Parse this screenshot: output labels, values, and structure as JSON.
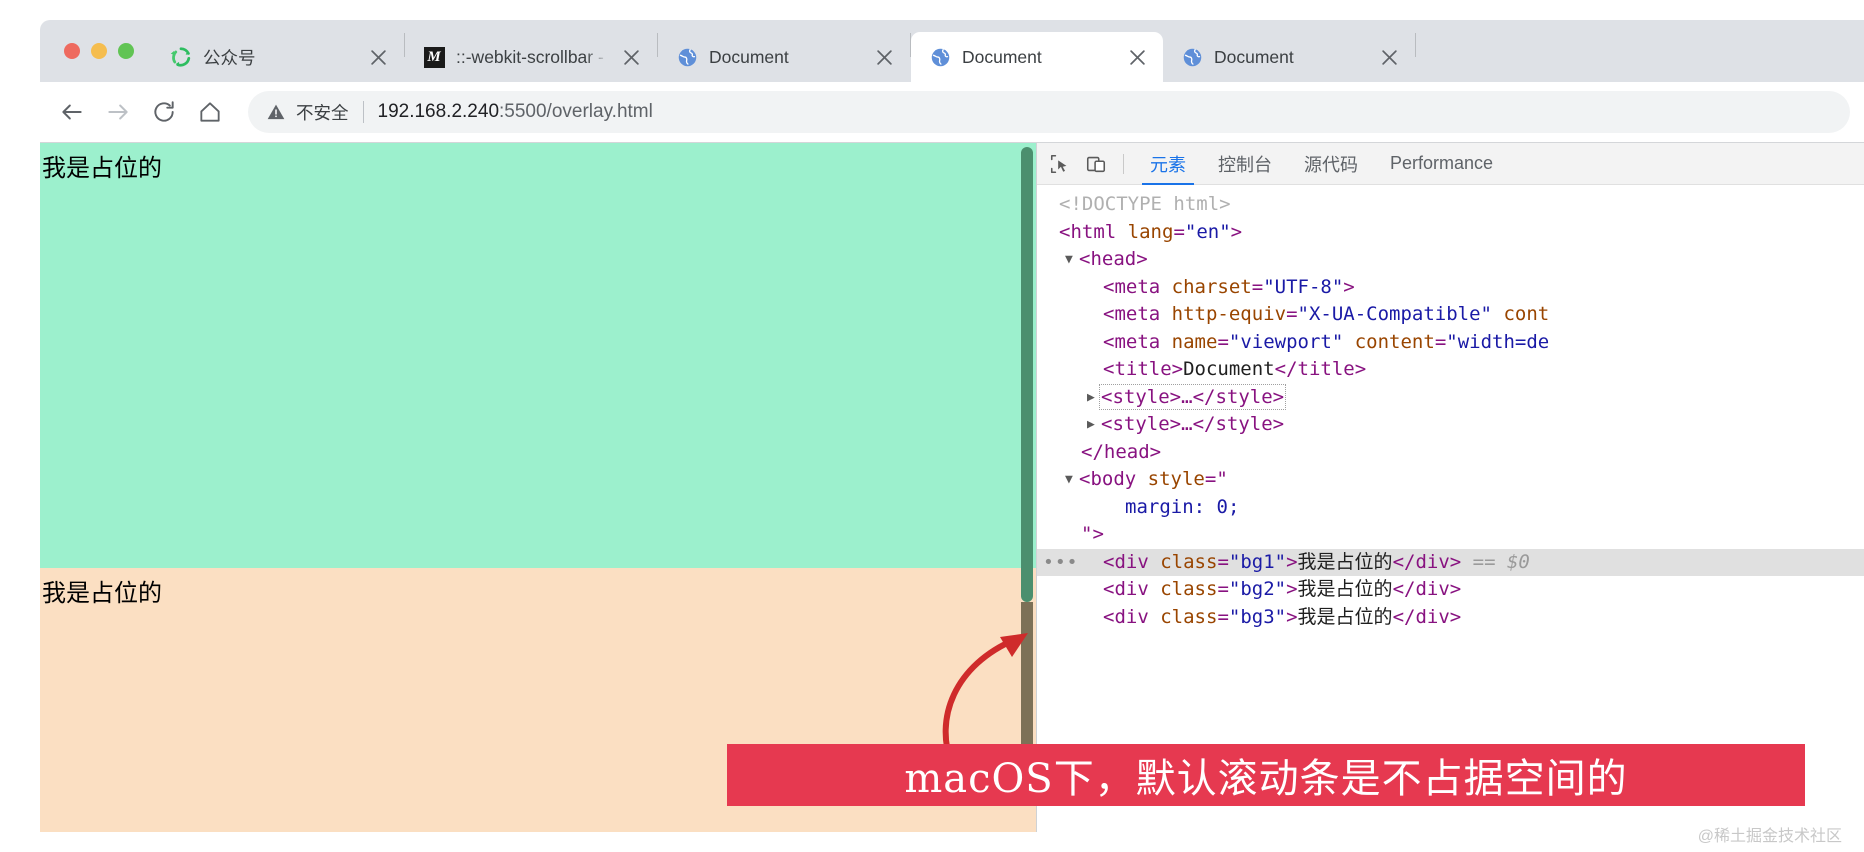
{
  "window": {
    "traffic_lights": [
      "close",
      "minimize",
      "maximize"
    ],
    "colors": {
      "close": "#ee6a5f",
      "minimize": "#f5bd4f",
      "maximize": "#61c454",
      "tabstrip_bg": "#dee1e6",
      "accent_blue": "#1a73e8",
      "banner_red": "#e63950",
      "page_bg1": "#9cf0cd",
      "page_bg2": "#fbdfc2",
      "scrollbar_thumb": "#4b8f6e"
    }
  },
  "tabs": [
    {
      "title": "公众号",
      "favicon": "recycle-green-icon",
      "active": false
    },
    {
      "title": "::-webkit-scrollbar - C",
      "favicon": "m-dark-icon",
      "active": false
    },
    {
      "title": "Document",
      "favicon": "globe-icon",
      "active": false
    },
    {
      "title": "Document",
      "favicon": "globe-icon",
      "active": true
    },
    {
      "title": "Document",
      "favicon": "globe-icon",
      "active": false
    }
  ],
  "toolbar": {
    "back": "←",
    "forward": "→",
    "reload": "⟳",
    "home": "⌂",
    "security_label": "不安全",
    "url_host": "192.168.2.240",
    "url_rest": ":5500/overlay.html"
  },
  "page": {
    "blocks": [
      {
        "class": "bg1",
        "text": "我是占位的"
      },
      {
        "class": "bg2",
        "text": "我是占位的"
      }
    ]
  },
  "devtools": {
    "icons": [
      "inspect-element-icon",
      "device-toolbar-icon"
    ],
    "tabs": [
      {
        "label": "元素",
        "active": true
      },
      {
        "label": "控制台",
        "active": false
      },
      {
        "label": "源代码",
        "active": false
      },
      {
        "label": "Performance",
        "active": false
      }
    ],
    "dom": [
      {
        "indent": 0,
        "twisty": "none",
        "selected": false,
        "ellipsis": false,
        "parts": [
          {
            "t": "doctype",
            "v": "<!DOCTYPE html>"
          }
        ]
      },
      {
        "indent": 0,
        "twisty": "none",
        "selected": false,
        "ellipsis": false,
        "parts": [
          {
            "t": "punct",
            "v": "<"
          },
          {
            "t": "tag",
            "v": "html"
          },
          {
            "t": "sp",
            "v": " "
          },
          {
            "t": "attr",
            "v": "lang"
          },
          {
            "t": "punct",
            "v": "="
          },
          {
            "t": "val",
            "v": "\"en\""
          },
          {
            "t": "punct",
            "v": ">"
          }
        ]
      },
      {
        "indent": 1,
        "twisty": "open",
        "selected": false,
        "ellipsis": false,
        "parts": [
          {
            "t": "punct",
            "v": "<"
          },
          {
            "t": "tag",
            "v": "head"
          },
          {
            "t": "punct",
            "v": ">"
          }
        ]
      },
      {
        "indent": 2,
        "twisty": "none",
        "selected": false,
        "ellipsis": false,
        "parts": [
          {
            "t": "punct",
            "v": "<"
          },
          {
            "t": "tag",
            "v": "meta"
          },
          {
            "t": "sp",
            "v": " "
          },
          {
            "t": "attr",
            "v": "charset"
          },
          {
            "t": "punct",
            "v": "="
          },
          {
            "t": "val",
            "v": "\"UTF-8\""
          },
          {
            "t": "punct",
            "v": ">"
          }
        ]
      },
      {
        "indent": 2,
        "twisty": "none",
        "selected": false,
        "ellipsis": false,
        "parts": [
          {
            "t": "punct",
            "v": "<"
          },
          {
            "t": "tag",
            "v": "meta"
          },
          {
            "t": "sp",
            "v": " "
          },
          {
            "t": "attr",
            "v": "http-equiv"
          },
          {
            "t": "punct",
            "v": "="
          },
          {
            "t": "val",
            "v": "\"X-UA-Compatible\""
          },
          {
            "t": "sp",
            "v": " "
          },
          {
            "t": "attr",
            "v": "cont"
          }
        ]
      },
      {
        "indent": 2,
        "twisty": "none",
        "selected": false,
        "ellipsis": false,
        "parts": [
          {
            "t": "punct",
            "v": "<"
          },
          {
            "t": "tag",
            "v": "meta"
          },
          {
            "t": "sp",
            "v": " "
          },
          {
            "t": "attr",
            "v": "name"
          },
          {
            "t": "punct",
            "v": "="
          },
          {
            "t": "val",
            "v": "\"viewport\""
          },
          {
            "t": "sp",
            "v": " "
          },
          {
            "t": "attr",
            "v": "content"
          },
          {
            "t": "punct",
            "v": "="
          },
          {
            "t": "val",
            "v": "\"width=de"
          }
        ]
      },
      {
        "indent": 2,
        "twisty": "none",
        "selected": false,
        "ellipsis": false,
        "parts": [
          {
            "t": "punct",
            "v": "<"
          },
          {
            "t": "tag",
            "v": "title"
          },
          {
            "t": "punct",
            "v": ">"
          },
          {
            "t": "text",
            "v": "Document"
          },
          {
            "t": "punct",
            "v": "</"
          },
          {
            "t": "tag",
            "v": "title"
          },
          {
            "t": "punct",
            "v": ">"
          }
        ]
      },
      {
        "indent": 2,
        "twisty": "closed",
        "selected": false,
        "ellipsis": false,
        "dotted": true,
        "parts": [
          {
            "t": "punct",
            "v": "<"
          },
          {
            "t": "tag",
            "v": "style"
          },
          {
            "t": "punct",
            "v": ">"
          },
          {
            "t": "tag",
            "v": "…"
          },
          {
            "t": "punct",
            "v": "</"
          },
          {
            "t": "tag",
            "v": "style"
          },
          {
            "t": "punct",
            "v": ">"
          }
        ]
      },
      {
        "indent": 2,
        "twisty": "closed",
        "selected": false,
        "ellipsis": false,
        "parts": [
          {
            "t": "punct",
            "v": "<"
          },
          {
            "t": "tag",
            "v": "style"
          },
          {
            "t": "punct",
            "v": ">"
          },
          {
            "t": "tag",
            "v": "…"
          },
          {
            "t": "punct",
            "v": "</"
          },
          {
            "t": "tag",
            "v": "style"
          },
          {
            "t": "punct",
            "v": ">"
          }
        ]
      },
      {
        "indent": 1,
        "twisty": "none",
        "selected": false,
        "ellipsis": false,
        "parts": [
          {
            "t": "punct",
            "v": "</"
          },
          {
            "t": "tag",
            "v": "head"
          },
          {
            "t": "punct",
            "v": ">"
          }
        ]
      },
      {
        "indent": 1,
        "twisty": "open",
        "selected": false,
        "ellipsis": false,
        "parts": [
          {
            "t": "punct",
            "v": "<"
          },
          {
            "t": "tag",
            "v": "body"
          },
          {
            "t": "sp",
            "v": " "
          },
          {
            "t": "attr",
            "v": "style"
          },
          {
            "t": "punct",
            "v": "=\""
          }
        ]
      },
      {
        "indent": 3,
        "twisty": "none",
        "selected": false,
        "ellipsis": false,
        "parts": [
          {
            "t": "val",
            "v": "margin: 0;"
          }
        ]
      },
      {
        "indent": 1,
        "twisty": "none",
        "selected": false,
        "ellipsis": false,
        "parts": [
          {
            "t": "punct",
            "v": "\">"
          }
        ]
      },
      {
        "indent": 2,
        "twisty": "none",
        "selected": true,
        "ellipsis": true,
        "parts": [
          {
            "t": "punct",
            "v": "<"
          },
          {
            "t": "tag",
            "v": "div"
          },
          {
            "t": "sp",
            "v": " "
          },
          {
            "t": "attr",
            "v": "class"
          },
          {
            "t": "punct",
            "v": "="
          },
          {
            "t": "val",
            "v": "\"bg1\""
          },
          {
            "t": "punct",
            "v": ">"
          },
          {
            "t": "text",
            "v": "我是占位的"
          },
          {
            "t": "punct",
            "v": "</"
          },
          {
            "t": "tag",
            "v": "div"
          },
          {
            "t": "punct",
            "v": ">"
          },
          {
            "t": "gray",
            "v": " == $0"
          }
        ]
      },
      {
        "indent": 2,
        "twisty": "none",
        "selected": false,
        "ellipsis": false,
        "parts": [
          {
            "t": "punct",
            "v": "<"
          },
          {
            "t": "tag",
            "v": "div"
          },
          {
            "t": "sp",
            "v": " "
          },
          {
            "t": "attr",
            "v": "class"
          },
          {
            "t": "punct",
            "v": "="
          },
          {
            "t": "val",
            "v": "\"bg2\""
          },
          {
            "t": "punct",
            "v": ">"
          },
          {
            "t": "text",
            "v": "我是占位的"
          },
          {
            "t": "punct",
            "v": "</"
          },
          {
            "t": "tag",
            "v": "div"
          },
          {
            "t": "punct",
            "v": ">"
          }
        ]
      },
      {
        "indent": 2,
        "twisty": "none",
        "selected": false,
        "ellipsis": false,
        "parts": [
          {
            "t": "punct",
            "v": "<"
          },
          {
            "t": "tag",
            "v": "div"
          },
          {
            "t": "sp",
            "v": " "
          },
          {
            "t": "attr",
            "v": "class"
          },
          {
            "t": "punct",
            "v": "="
          },
          {
            "t": "val",
            "v": "\"bg3\""
          },
          {
            "t": "punct",
            "v": ">"
          },
          {
            "t": "text",
            "v": "我是占位的"
          },
          {
            "t": "punct",
            "v": "</"
          },
          {
            "t": "tag",
            "v": "div"
          },
          {
            "t": "punct",
            "v": ">"
          }
        ]
      }
    ]
  },
  "annotation": {
    "arrow": "red-curved-arrow",
    "banner_text": "macOS下，默认滚动条是不占据空间的"
  },
  "watermark": "@稀土掘金技术社区"
}
